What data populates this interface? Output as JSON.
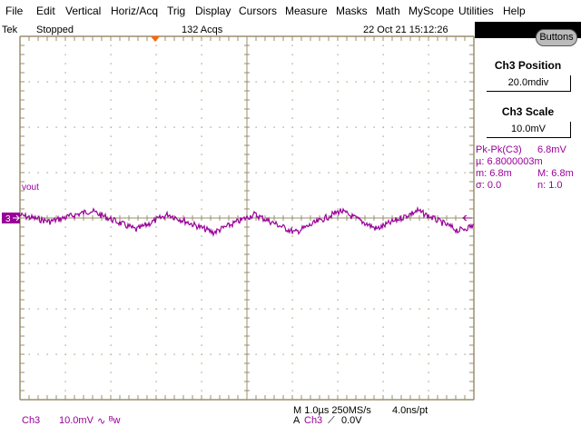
{
  "menu": [
    "File",
    "Edit",
    "Vertical",
    "Horiz/Acq",
    "Trig",
    "Display",
    "Cursors",
    "Measure",
    "Masks",
    "Math",
    "MyScope",
    "Utilities",
    "Help"
  ],
  "status": {
    "brand": "Tek",
    "run_state": "Stopped",
    "acqs": "132 Acqs",
    "datetime": "22 Oct 21 15:12:26"
  },
  "buttons_label": "Buttons",
  "panel": {
    "position_title": "Ch3 Position",
    "position_value": "20.0mdiv",
    "scale_title": "Ch3 Scale",
    "scale_value": "10.0mV"
  },
  "measurement": {
    "label": "Pk-Pk(C3)",
    "value": "6.8mV",
    "mean": "µ: 6.8000003m",
    "min": "m: 6.8m",
    "max": "M: 6.8m",
    "sigma": "σ: 0.0",
    "n": "n:  1.0"
  },
  "trace": {
    "label": "vout",
    "channel_marker": "3",
    "color": "#990099"
  },
  "bottom": {
    "channel": "Ch3",
    "scale": "10.0mV",
    "coupling": "∿",
    "bw": "ᴮw",
    "horiz": "M 1.0µs 250MS/s",
    "resolution": "4.0ns/pt",
    "trig_mode": "A",
    "trig_source": "Ch3",
    "trig_slope": "⟋",
    "trig_level": "0.0V"
  },
  "colors": {
    "graticule": "#9a8f6e",
    "trace": "#990099",
    "trigger_marker": "#ff6600"
  }
}
